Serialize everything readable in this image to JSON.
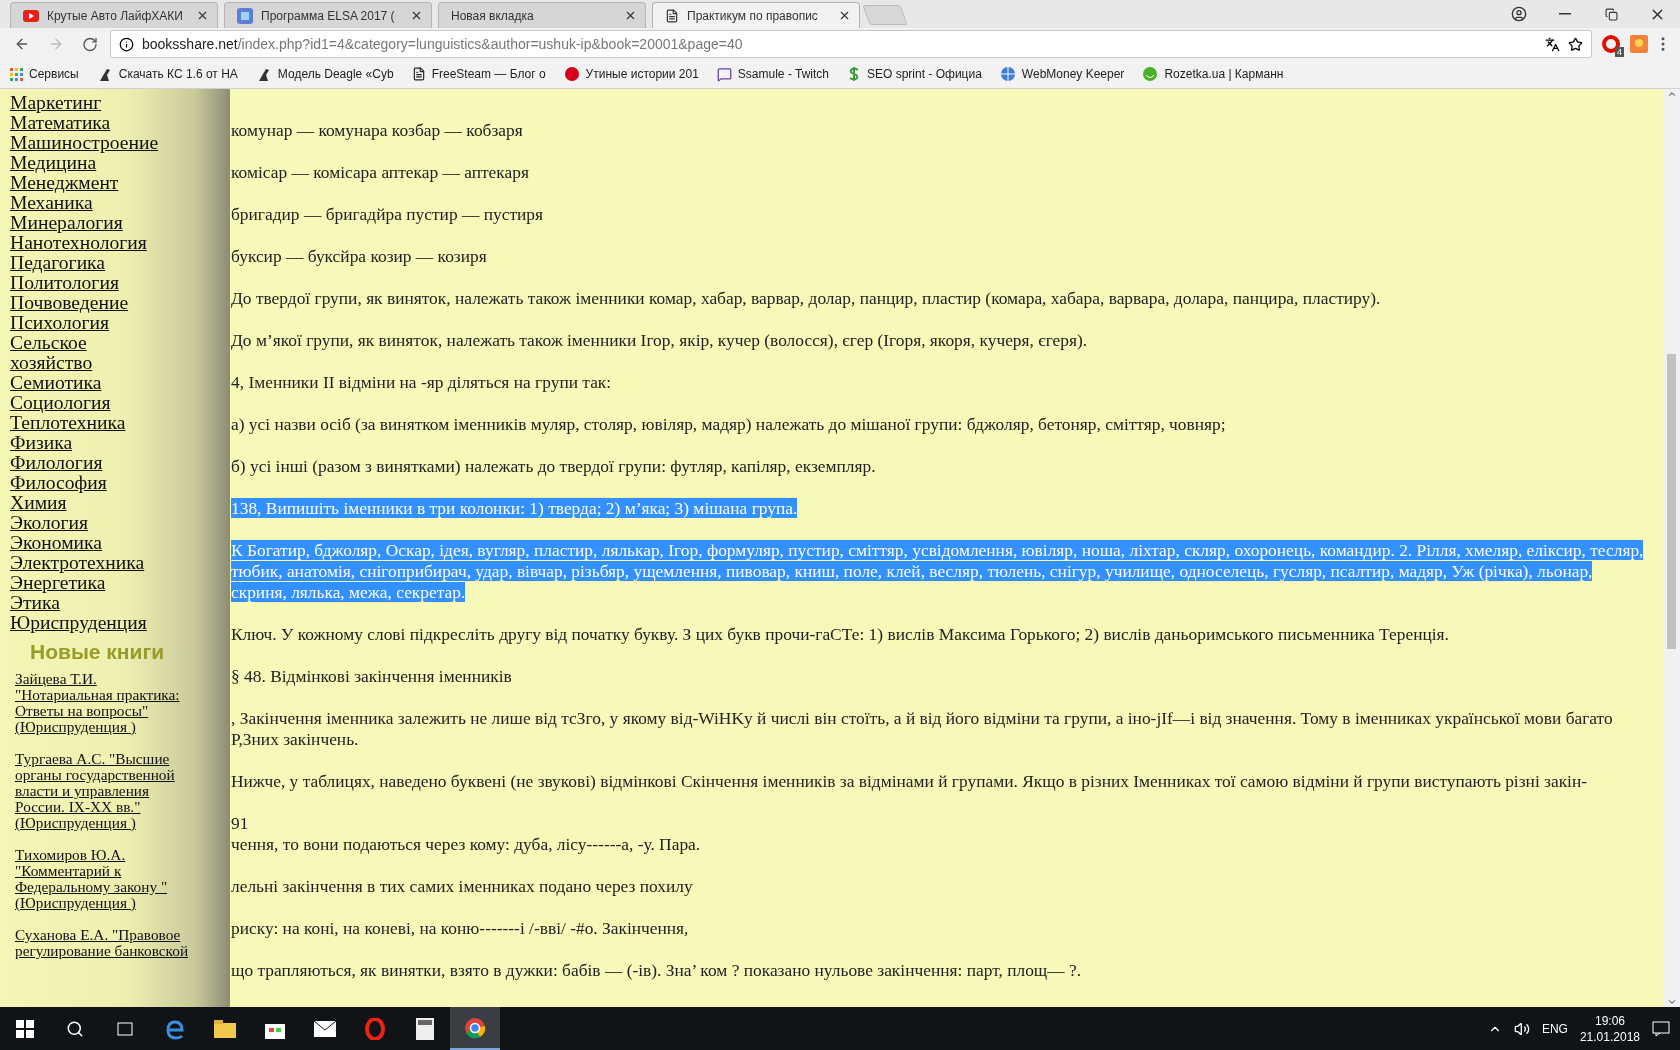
{
  "tabs": [
    {
      "title": "Крутые Авто ЛайфХАКИ",
      "selected": false
    },
    {
      "title": "Программа ELSA 2017 (",
      "selected": false
    },
    {
      "title": "Новая вкладка",
      "selected": false
    },
    {
      "title": "Практикум по правопис",
      "selected": true
    }
  ],
  "address": {
    "domain": "booksshare.net",
    "path": "/index.php?id1=4&category=lunguistics&author=ushuk-ip&book=20001&page=40"
  },
  "extension_badge": "4",
  "bookmarks": [
    {
      "label": "Сервисы"
    },
    {
      "label": "Скачать КС 1.6 от НА"
    },
    {
      "label": "Модель Deagle «Cyb"
    },
    {
      "label": "FreeSteam — Блог о"
    },
    {
      "label": "Утиные истории 201"
    },
    {
      "label": "Ssamule - Twitch"
    },
    {
      "label": "SEO sprint - Официа"
    },
    {
      "label": "WebMoney Keeper"
    },
    {
      "label": "Rozetka.ua | Карманн"
    }
  ],
  "categories": [
    "Маркетинг",
    "Математика",
    "Машиностроение",
    "Медицина",
    "Менеджмент",
    "Механика",
    "Минералогия",
    "Нанотехнология",
    "Педагогика",
    "Политология",
    "Почвоведение",
    "Психология",
    "Сельское хозяйство",
    "Семиотика",
    "Социология",
    "Теплотехника",
    "Физика",
    "Филология",
    "Философия",
    "Химия",
    "Экология",
    "Экономика",
    "Электротехника",
    "Энергетика",
    "Этика",
    "Юриспруденция"
  ],
  "new_books_heading": "Новые книги",
  "new_books": [
    "Зайцева Т.И. \"Нотариальная практика: Ответы на вопросы\" (Юриспруденция )",
    "Тургаева А.С. \"Высшие органы государственной власти и управления России. IX-XX вв.\" (Юриспруденция )",
    "Тихомиров Ю.А. \"Комментарий к Федеральному закону \" (Юриспруденция )",
    "Суханова Е.А. \"Правовое регулирование банковской"
  ],
  "paragraphs": [
    {
      "kind": "text",
      "selected": false,
      "text": "комунар — комунара козбар — кобзаря"
    },
    {
      "kind": "text",
      "selected": false,
      "text": "комісар — комісара аптекар — аптекаря"
    },
    {
      "kind": "text",
      "selected": false,
      "text": "бригадир — бригадйра пустир — пустиря"
    },
    {
      "kind": "text",
      "selected": false,
      "text": "буксир — буксйра козир — козиря"
    },
    {
      "kind": "text",
      "selected": false,
      "text": "До твердої групи, як виняток, належать також іменники комар, хабар, варвар, долар, панцир, пластир (комара, хабара, варвара, долара, панцира, пластиру)."
    },
    {
      "kind": "text",
      "selected": false,
      "text": "До м’якої групи, як виняток, належать також іменники Ігор, якір, кучер (волосся), єгер (Ігоря, якоря, кучеря, єгеря)."
    },
    {
      "kind": "text",
      "selected": false,
      "text": "4, Іменники II відміни на -яр діляться на групи так:"
    },
    {
      "kind": "text",
      "selected": false,
      "text": "а) усі назви осіб (за винятком іменників муляр, столяр, ювіляр, мадяр) належать до мішаної групи: бджоляр, бетоняр, сміттяр, човняр;"
    },
    {
      "kind": "text",
      "selected": false,
      "text": "б) усі інші (разом з винятками) належать до твердої групи: футляр, капіляр, екземпляр."
    },
    {
      "kind": "text",
      "selected": true,
      "text": "138, Випишіть іменники в три колонки: 1) тверда; 2) м’яка; 3) мішана група. "
    },
    {
      "kind": "text",
      "selected": true,
      "text": "К Богатир, бджоляр, Оскар, ідея, вугляр, пластир, лялькар, Ігор, формуляр, пустир, сміттяр, усвідомлення, ювіляр, ноша, ліхтар, скляр, охоронець, командир. 2. Рілля, хмеляр, еліксир, тесляр, тюбик, анатомія, снігоприбирач, удар, вівчар, різьбяр, ущемлення, пивовар, книш, поле, клей, весляр, тюлень, снігур, училище, односелець, гусляр, псалтир, мадяр, Уж (річка), льонар, скриня, лялька, межа, секретар."
    },
    {
      "kind": "text",
      "selected": false,
      "text": "Ключ. У кожному слові підкресліть другу від початку букву. З цих букв прочи-гаСТе: 1) вислів Максима Горького; 2) вислів даньоримського письменника Теренція."
    },
    {
      "kind": "text",
      "selected": false,
      "text": "§ 48. Відмінкові закінчення іменників"
    },
    {
      "kind": "text",
      "selected": false,
      "text": ", Закінчення іменника залежить не лише від тсЗго, у якому від-WiHKy й числі він стоїть, а й від його відміни та групи, а іно-jIf—і від значення. Тому в іменниках української мови багато Р,Зних закінчень."
    },
    {
      "kind": "text",
      "selected": false,
      "text": "Нижче, у таблицях, наведено буквені (не звукові) відмінкові Скінчення іменників за відмінами й групами. Якщо в різних Іменниках тої самою відміни й групи виступають різні закін-"
    },
    {
      "kind": "page_number",
      "selected": false,
      "text": "91"
    },
    {
      "kind": "text",
      "selected": false,
      "text": "чення, то вони подаються через кому: дуба, лісу------а, -у. Пара."
    },
    {
      "kind": "text",
      "selected": false,
      "text": "лельні закінчення в тих самих іменниках подано через похилу"
    },
    {
      "kind": "text",
      "selected": false,
      "text": "риску: на коні, на коневі, на коню-------і /-вві/ -#о. Закінчення,"
    },
    {
      "kind": "text",
      "selected": false,
      "text": "що трапляються, як винятки, взято в дужки: бабів — (-ів). Зна’ ком ? показано нульове закінчення: парт, площ— ?."
    }
  ],
  "taskbar": {
    "language": "ENG",
    "time": "19:06",
    "date": "21.01.2018"
  }
}
